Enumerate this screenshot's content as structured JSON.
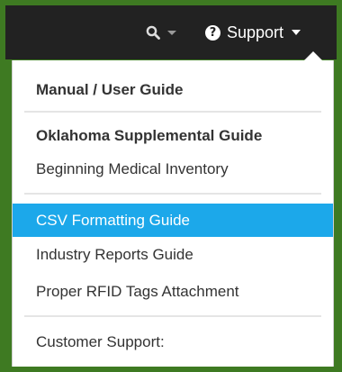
{
  "navbar": {
    "search_icon": "search-icon",
    "support_icon": "question-circle-icon",
    "support_label": "Support"
  },
  "menu": {
    "items": [
      {
        "label": "Manual / User Guide",
        "bold": true
      },
      {
        "label": "Oklahoma Supplemental Guide",
        "bold": true
      },
      {
        "label": "Beginning Medical Inventory"
      },
      {
        "label": "CSV Formatting Guide",
        "active": true
      },
      {
        "label": "Industry Reports Guide"
      },
      {
        "label": "Proper RFID Tags Attachment"
      },
      {
        "label": "Customer Support:"
      }
    ]
  },
  "colors": {
    "frame": "#3e7a22",
    "navbar": "#222222",
    "active_item": "#1ca8ea"
  }
}
